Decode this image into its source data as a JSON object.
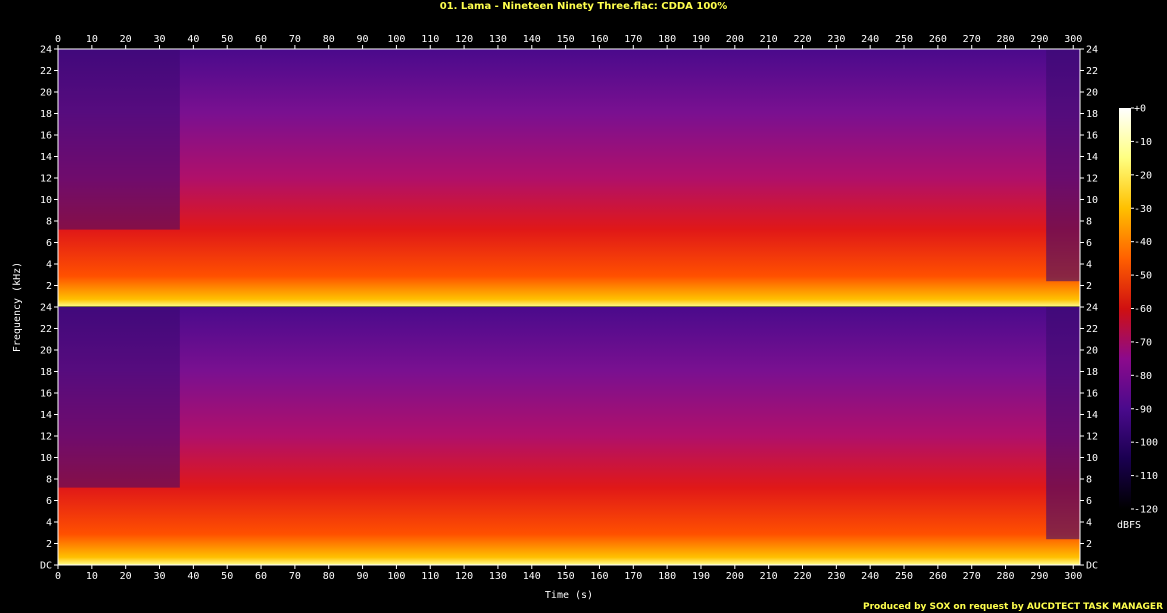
{
  "title": "01. Lama - Nineteen Ninety Three.flac: CDDA 100%",
  "footer": "Produced by SOX on request by AUCDTECT TASK MANAGER",
  "chart_data": {
    "type": "heatmap",
    "xlabel": "Time (s)",
    "ylabel": "Frequency (kHz)",
    "xlim": [
      0,
      302
    ],
    "ylim": [
      0,
      24
    ],
    "x_ticks": [
      "0",
      "10",
      "20",
      "30",
      "40",
      "50",
      "60",
      "70",
      "80",
      "90",
      "100",
      "110",
      "120",
      "130",
      "140",
      "150",
      "160",
      "170",
      "180",
      "190",
      "200",
      "210",
      "220",
      "230",
      "240",
      "250",
      "260",
      "270",
      "280",
      "290",
      "300"
    ],
    "y_ticks": [
      "DC",
      "2",
      "4",
      "6",
      "8",
      "10",
      "12",
      "14",
      "16",
      "18",
      "20",
      "22",
      "24"
    ],
    "channels": 2,
    "colorbar": {
      "label": "dBFS",
      "ticks": [
        "+0",
        "-10",
        "-20",
        "-30",
        "-40",
        "-50",
        "-60",
        "-70",
        "-80",
        "-90",
        "-100",
        "-110",
        "-120"
      ],
      "range": [
        -120,
        0
      ]
    },
    "colormap": [
      "#000000",
      "#1a0050",
      "#4a0a8c",
      "#8c0a8c",
      "#d01010",
      "#ff6000",
      "#ffc000",
      "#ffff80",
      "#ffffff"
    ]
  }
}
